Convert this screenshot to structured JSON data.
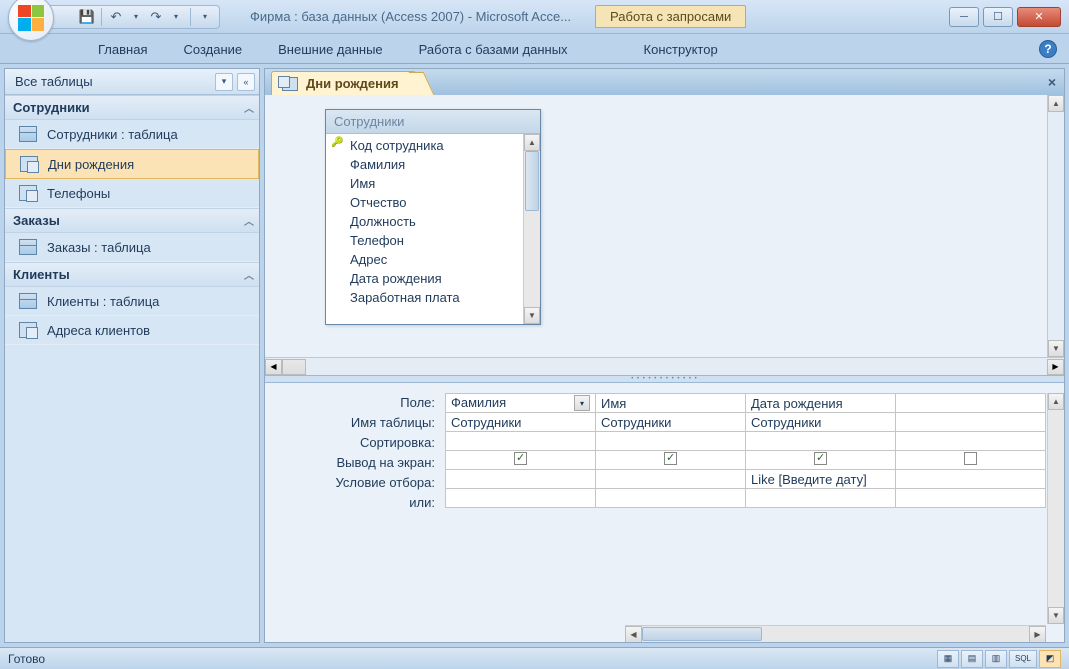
{
  "titlebar": {
    "title": "Фирма : база данных (Access 2007)  -  Microsoft Acce...",
    "context_tab": "Работа с запросами"
  },
  "ribbon": {
    "tabs": [
      "Главная",
      "Создание",
      "Внешние данные",
      "Работа с базами данных",
      "Конструктор"
    ]
  },
  "nav": {
    "header": "Все таблицы",
    "groups": [
      {
        "name": "Сотрудники",
        "items": [
          {
            "label": "Сотрудники : таблица",
            "icon": "table",
            "selected": false
          },
          {
            "label": "Дни рождения",
            "icon": "query",
            "selected": true
          },
          {
            "label": "Телефоны",
            "icon": "query",
            "selected": false
          }
        ]
      },
      {
        "name": "Заказы",
        "items": [
          {
            "label": "Заказы : таблица",
            "icon": "table",
            "selected": false
          }
        ]
      },
      {
        "name": "Клиенты",
        "items": [
          {
            "label": "Клиенты : таблица",
            "icon": "table",
            "selected": false
          },
          {
            "label": "Адреса клиентов",
            "icon": "query",
            "selected": false
          }
        ]
      }
    ]
  },
  "document": {
    "tab_label": "Дни рождения",
    "table_box": {
      "title": "Сотрудники",
      "fields": [
        "Код сотрудника",
        "Фамилия",
        "Имя",
        "Отчество",
        "Должность",
        "Телефон",
        "Адрес",
        "Дата рождения",
        "Заработная плата"
      ],
      "pk_index": 0
    },
    "grid": {
      "row_labels": [
        "Поле:",
        "Имя таблицы:",
        "Сортировка:",
        "Вывод на экран:",
        "Условие отбора:",
        "или:"
      ],
      "columns": [
        {
          "field": "Фамилия",
          "table": "Сотрудники",
          "sort": "",
          "show": true,
          "criteria": "",
          "or": "",
          "dropdown": true
        },
        {
          "field": "Имя",
          "table": "Сотрудники",
          "sort": "",
          "show": true,
          "criteria": "",
          "or": ""
        },
        {
          "field": "Дата рождения",
          "table": "Сотрудники",
          "sort": "",
          "show": true,
          "criteria": "Like [Введите дату]",
          "or": ""
        }
      ]
    }
  },
  "statusbar": {
    "text": "Готово",
    "sql_label": "SQL"
  }
}
